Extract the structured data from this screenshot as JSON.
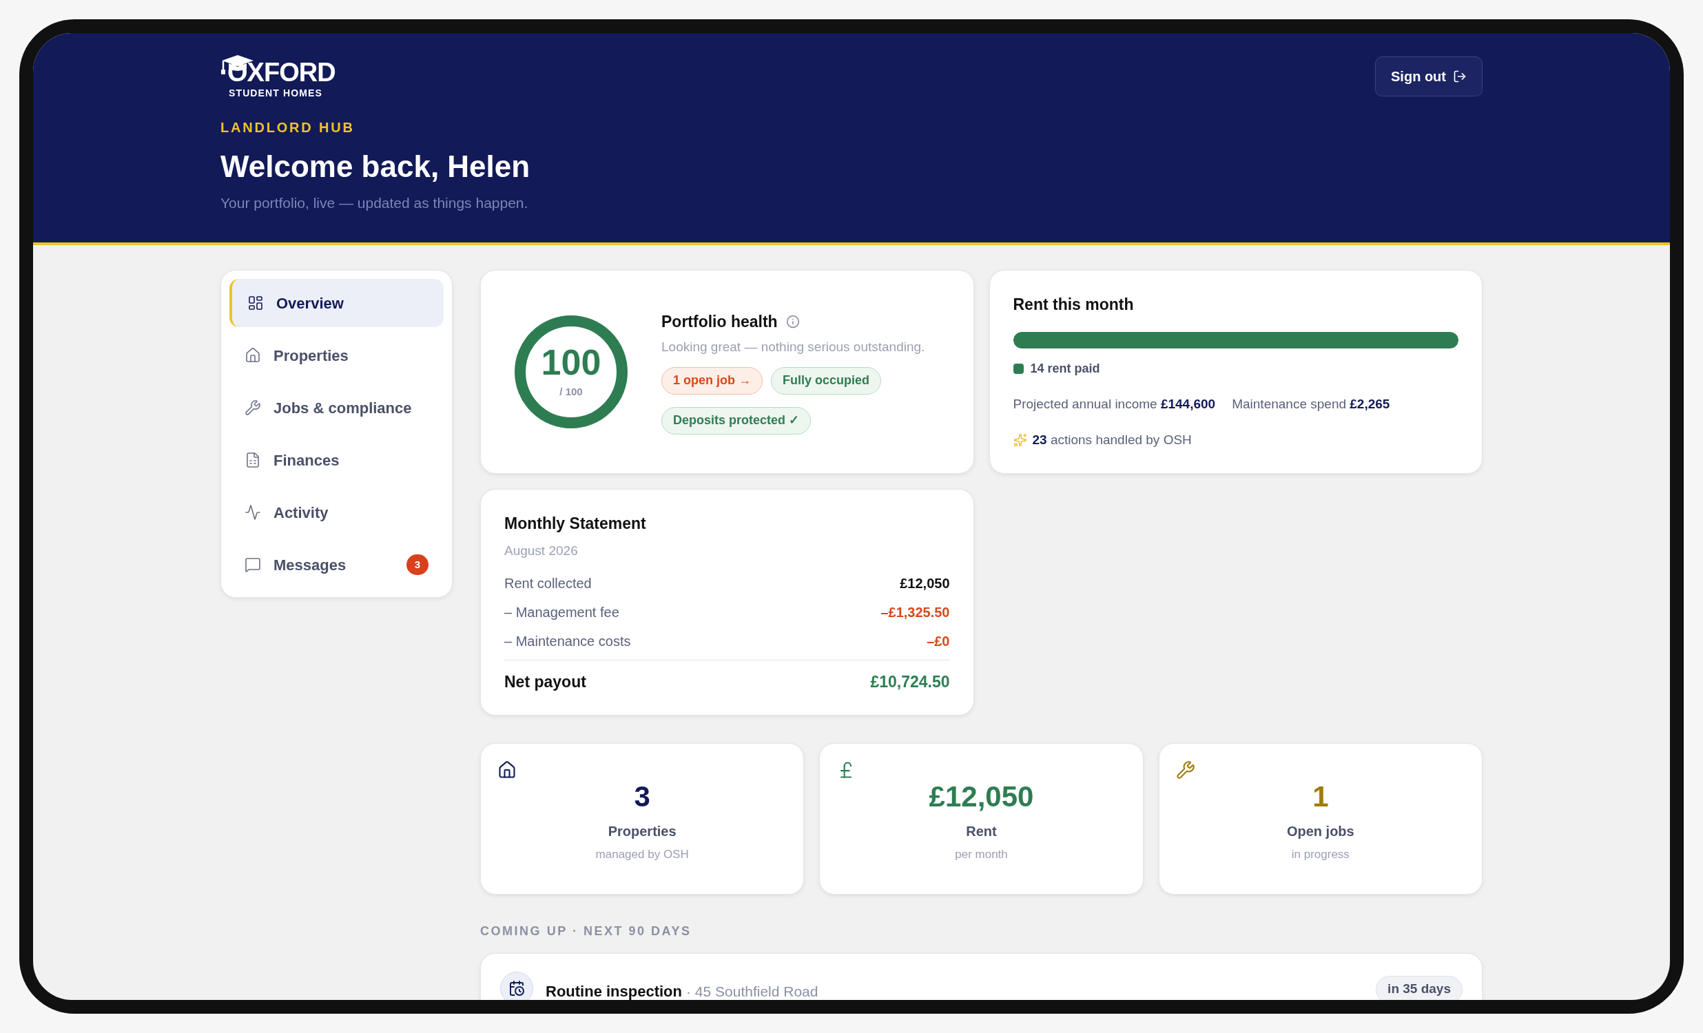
{
  "brand": {
    "name": "OXFORD",
    "tagline": "STUDENT HOMES"
  },
  "header": {
    "eyebrow": "LANDLORD HUB",
    "title": "Welcome back, Helen",
    "subtitle": "Your portfolio, live — updated as things happen.",
    "sign_out": "Sign out"
  },
  "sidebar": {
    "items": [
      {
        "label": "Overview",
        "selected": true
      },
      {
        "label": "Properties",
        "selected": false
      },
      {
        "label": "Jobs & compliance",
        "selected": false
      },
      {
        "label": "Finances",
        "selected": false
      },
      {
        "label": "Activity",
        "selected": false
      },
      {
        "label": "Messages",
        "selected": false,
        "badge": "3"
      }
    ]
  },
  "health": {
    "title": "Portfolio health",
    "score": "100",
    "out_of": "/ 100",
    "level": 1,
    "summary": "Looking great — nothing serious outstanding.",
    "chips": [
      {
        "label": "1 open job →",
        "kind": "alert"
      },
      {
        "label": "Fully occupied",
        "kind": "ok"
      },
      {
        "label": "Deposits protected ✓",
        "kind": "ok"
      }
    ]
  },
  "rent": {
    "title": "Rent this month",
    "level": 1,
    "legend": "14 rent paid",
    "facts": [
      "Projected annual income **£144,600**",
      "Maintenance spend **£2,265**"
    ],
    "actions": "**23** actions handled by OSH"
  },
  "statement": {
    "title": "Monthly Statement",
    "period": "August 2026",
    "rows": [
      {
        "label": "Rent collected",
        "amount": "£12,050",
        "kind": "income"
      },
      {
        "label": "– Management fee",
        "amount": "–£1,325.50",
        "kind": "deduction"
      },
      {
        "label": "– Maintenance costs",
        "amount": "–£0",
        "kind": "deduction"
      }
    ],
    "total": {
      "label": "Net payout",
      "amount": "£10,724.50"
    }
  },
  "stats": [
    {
      "kind": "properties",
      "value": "3",
      "label": "Properties",
      "note": "managed by OSH"
    },
    {
      "kind": "rent",
      "value": "£12,050",
      "label": "Rent",
      "note": "per month"
    },
    {
      "kind": "jobs",
      "value": "1",
      "label": "Open jobs",
      "note": "in progress"
    }
  ],
  "upcoming": {
    "heading": "COMING UP · NEXT 90 DAYS",
    "items": [
      {
        "title": "Routine inspection",
        "place": "· 45 Southfield Road",
        "when": "in 35 days"
      }
    ]
  }
}
